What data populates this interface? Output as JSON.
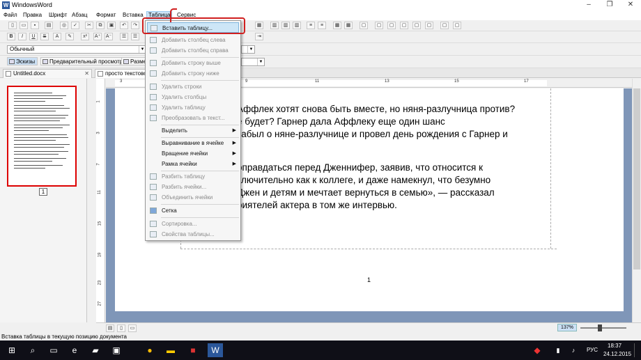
{
  "window": {
    "title": "WindowsWord"
  },
  "menubar": {
    "items": [
      "Файл",
      "Правка",
      "Шрифт",
      "Абзац",
      "Формат",
      "Вставка",
      "Таблица",
      "Сервис"
    ]
  },
  "format": {
    "style": "Обычный"
  },
  "view": {
    "sketches": "Эскизы",
    "preview": "Предварительный просмотр",
    "size_btn": "Разме"
  },
  "tabs": [
    {
      "label": "Untitled.docx"
    },
    {
      "label": "просто текстово"
    }
  ],
  "table_menu": {
    "insert": "Вставить таблицу...",
    "add_col_left": "Добавить столбец слева",
    "add_col_right": "Добавить столбец справа",
    "add_row_above": "Добавить строку выше",
    "add_row_below": "Добавить строку ниже",
    "del_rows": "Удалить строки",
    "del_cols": "Удалить столбцы",
    "del_table": "Удалить таблицу",
    "convert": "Преобразовать в текст...",
    "select": "Выделить",
    "align": "Выравнивание в ячейке",
    "rotate": "Вращение ячейки",
    "border": "Рамка ячейки",
    "split_table": "Разбить таблицу",
    "split_cells": "Разбить ячейки...",
    "merge": "Объединить ячейки",
    "grid": "Сетка",
    "sort": "Сортировка...",
    "props": "Свойства таблицы..."
  },
  "document": {
    "lines": [
      "Аффлек хотят снова быть вместе, но няня-разлучница против?",
      "е будет? Гарнер дала Аффлеку еще один шанс",
      "забыл о няне-разлучнице и провел день рождения с Гарнер и",
      "",
      "оправдаться перед Дженнифер, заявив, что относится к",
      "ключительно как к коллеге, и даже намекнул, что безумно",
      "Джен и детям и мечтает вернуться в семью», — рассказал",
      "риятелей актера в том же интервью."
    ],
    "page_number": "1"
  },
  "thumbnails": {
    "page_number": "1"
  },
  "statusbar": {
    "text": "Вставка таблицы в текущую позицию документа"
  },
  "zoom": {
    "label": "137%"
  },
  "taskbar": {
    "lang": "РУС",
    "time": "18:37",
    "date": "24.12.2015"
  }
}
